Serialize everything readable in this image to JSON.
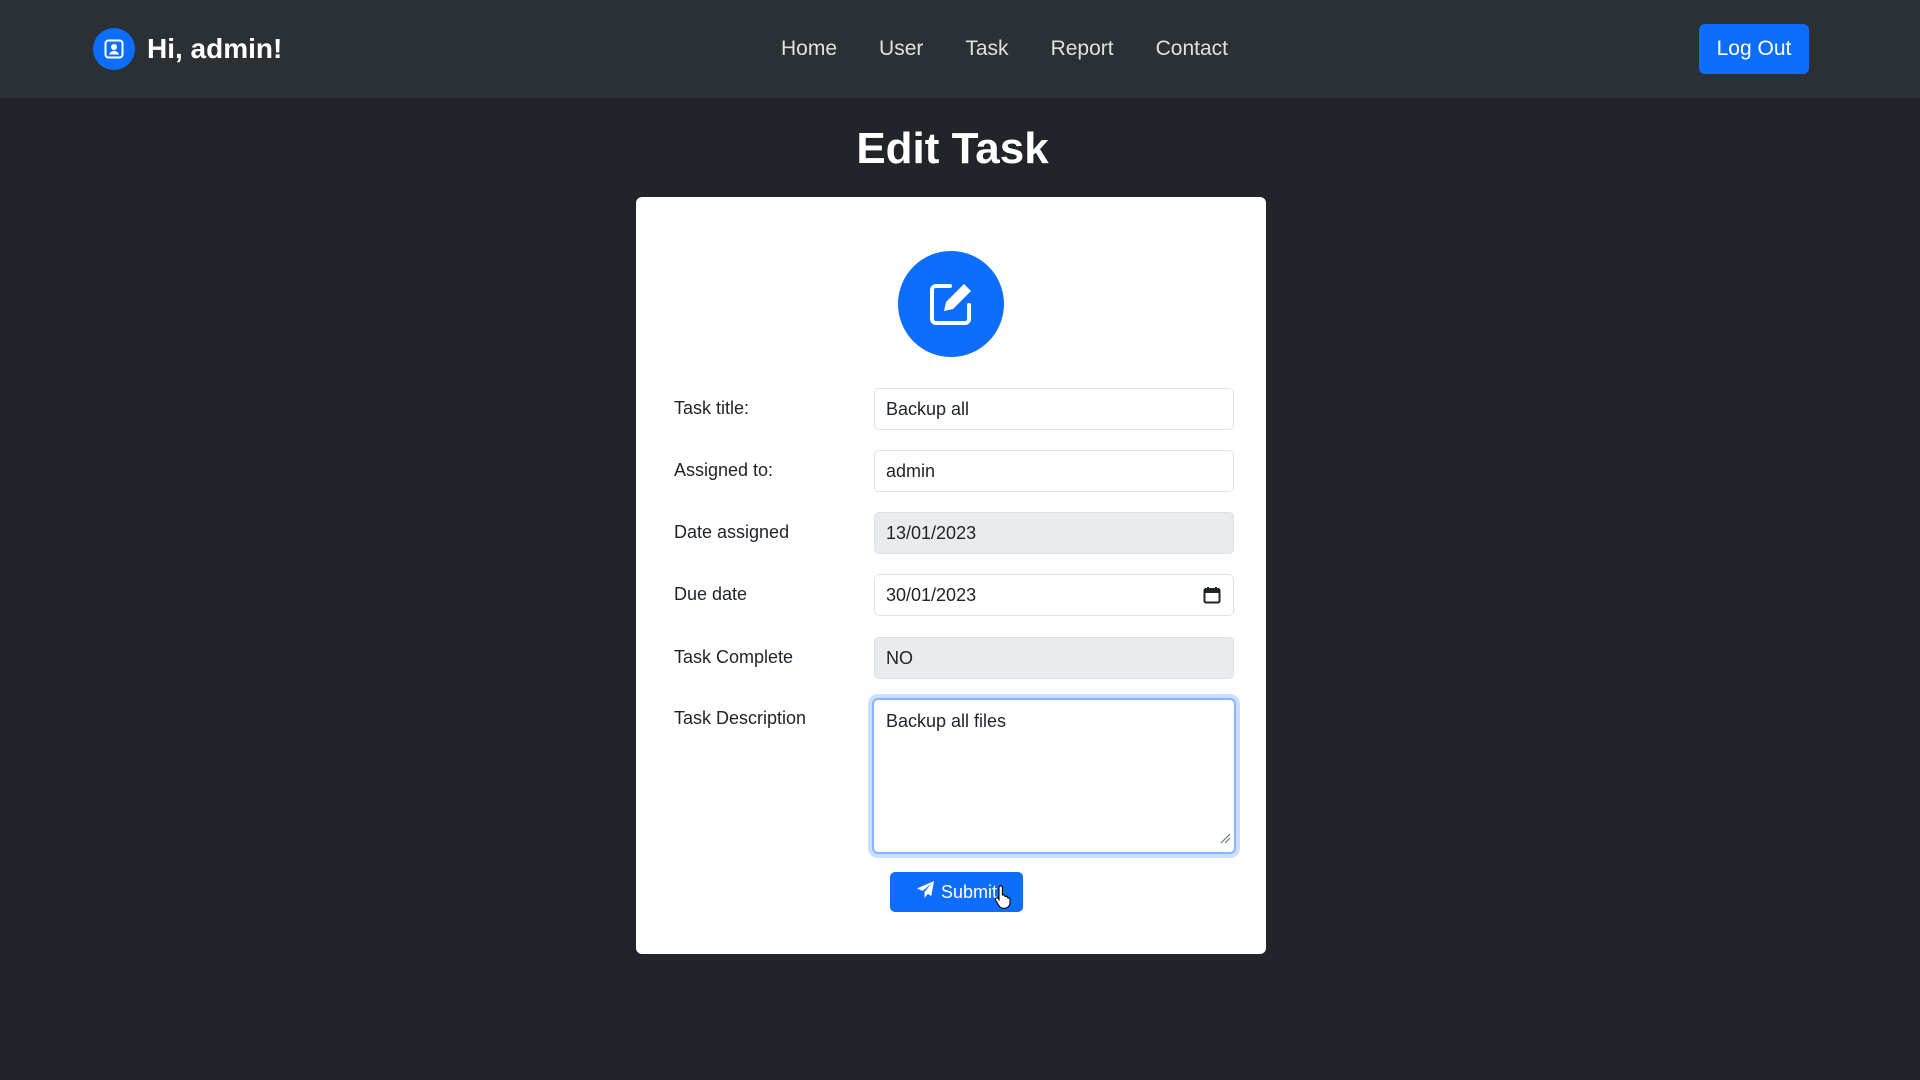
{
  "header": {
    "greeting": "Hi, admin!",
    "nav": [
      "Home",
      "User",
      "Task",
      "Report",
      "Contact"
    ],
    "logout_label": "Log Out",
    "brand_icon": "user-badge-icon"
  },
  "page": {
    "title": "Edit Task"
  },
  "form": {
    "header_icon": "edit-icon",
    "fields": {
      "title": {
        "label": "Task title:",
        "value": "Backup all"
      },
      "assigned": {
        "label": "Assigned to:",
        "value": "admin"
      },
      "date_assigned": {
        "label": "Date assigned",
        "value": "13/01/2023"
      },
      "due_date": {
        "label": "Due date",
        "value": "30/01/2023"
      },
      "complete": {
        "label": "Task Complete",
        "value": "NO"
      },
      "description": {
        "label": "Task Description",
        "value": "Backup all files"
      }
    },
    "submit_label": "Submit"
  },
  "colors": {
    "accent": "#0d6efd",
    "background": "#212529",
    "navbar": "#2b3035"
  }
}
